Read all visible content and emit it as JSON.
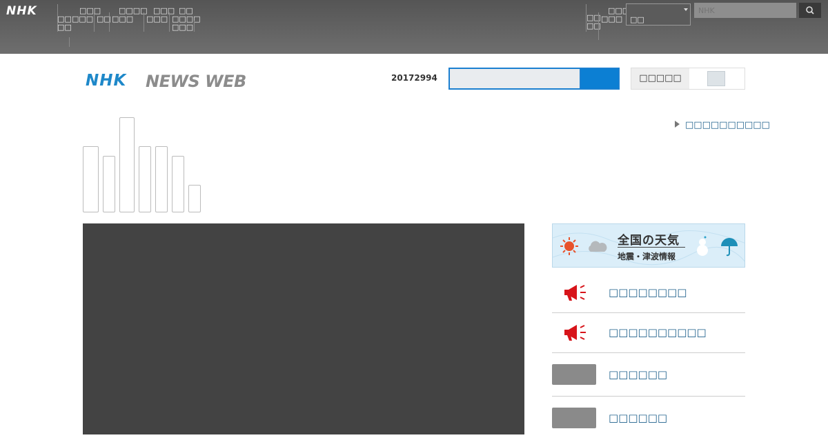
{
  "global_bar": {
    "logo": "NHK",
    "nav_items": [
      [
        "□□",
        "□□"
      ],
      [
        "□□□",
        "□□□"
      ],
      [
        "□□"
      ],
      [
        "□□□□",
        "□□□"
      ],
      [
        "□□□",
        "□□□"
      ],
      [
        "□□",
        "□□□□",
        "□□□"
      ]
    ],
    "right_items": [
      [
        "□□",
        "□□"
      ],
      [
        "□□□",
        "□□□"
      ]
    ],
    "select_value": "□□",
    "search_placeholder": "NHK"
  },
  "header": {
    "brand_nhk": "NHK",
    "brand_news": "NEWS WEB",
    "date": "20172994",
    "toggle_label": "□□□□□"
  },
  "top_link": "□□□□□□□□□□",
  "weather_banner": {
    "title": "全国の天気",
    "subtitle": "地震・津波情報"
  },
  "right_list": [
    {
      "label": "□□□□□□□□",
      "icon": "megaphone-icon"
    },
    {
      "label": "□□□□□□□□□□",
      "icon": "megaphone-icon"
    },
    {
      "label": "□□□□□□",
      "icon": "thumbnail"
    },
    {
      "label": "□□□□□□",
      "icon": "thumbnail"
    }
  ],
  "colors": {
    "brand_blue": "#1e88c9",
    "link": "#1b5e8a",
    "megaphone_red": "#d7141a",
    "search_blue": "#0c7fd3"
  }
}
